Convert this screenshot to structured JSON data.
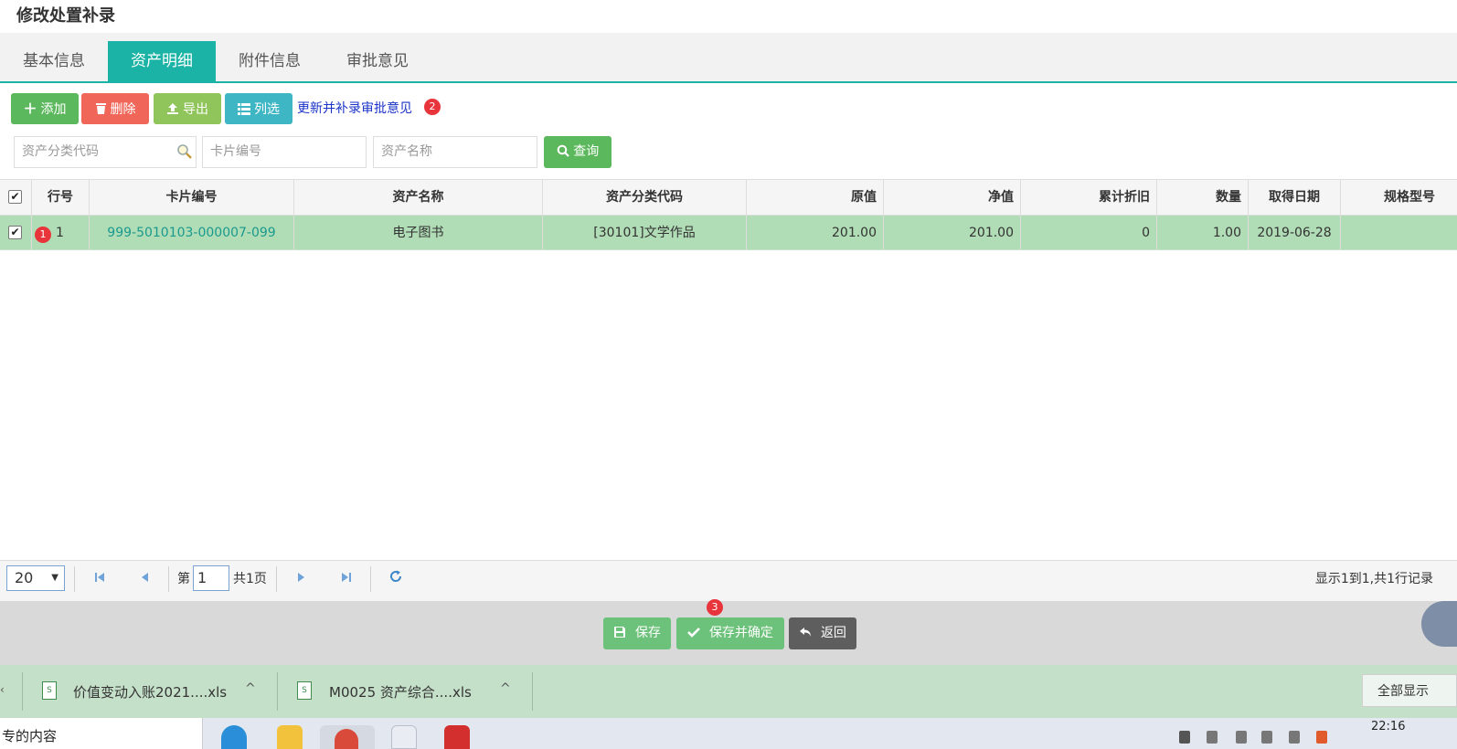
{
  "page": {
    "title": "修改处置补录"
  },
  "tabs": [
    {
      "label": "基本信息",
      "active": false
    },
    {
      "label": "资产明细",
      "active": true
    },
    {
      "label": "附件信息",
      "active": false
    },
    {
      "label": "审批意见",
      "active": false
    }
  ],
  "toolbar": {
    "add_label": "添加",
    "delete_label": "删除",
    "export_label": "导出",
    "columns_label": "列选",
    "update_link": "更新并补录审批意见",
    "badge2": "2"
  },
  "search": {
    "category_placeholder": "资产分类代码",
    "card_placeholder": "卡片编号",
    "name_placeholder": "资产名称",
    "query_label": "查询"
  },
  "grid": {
    "columns": {
      "row_no": "行号",
      "card_no": "卡片编号",
      "asset_name": "资产名称",
      "category_code": "资产分类代码",
      "original_value": "原值",
      "net_value": "净值",
      "accum_depr": "累计折旧",
      "quantity": "数量",
      "acquire_date": "取得日期",
      "spec_model": "规格型号"
    },
    "rows": [
      {
        "badge": "1",
        "row_no": "1",
        "card_no": "999-5010103-000007-099",
        "asset_name": "电子图书",
        "category_code": "[30101]文学作品",
        "original_value": "201.00",
        "net_value": "201.00",
        "accum_depr": "0",
        "quantity": "1.00",
        "acquire_date": "2019-06-28",
        "spec_model": ""
      }
    ]
  },
  "pager": {
    "page_size": "20",
    "page_prefix": "第",
    "current_page": "1",
    "page_total": "共1页",
    "summary": "显示1到1,共1行记录"
  },
  "footer": {
    "badge3": "3",
    "save_label": "保存",
    "confirm_label": "保存并确定",
    "back_label": "返回"
  },
  "downloads": {
    "items": [
      {
        "name": "价值变动入账2021....xls"
      },
      {
        "name": "M0025 资产综合....xls"
      }
    ],
    "show_all": "全部显示"
  },
  "taskbar": {
    "search_text": "专的内容",
    "clock": "22:16"
  },
  "colors": {
    "accent": "#1ab3a5",
    "selected_row": "#b0dcb6",
    "success": "#5cb85c",
    "danger": "#f0675a",
    "badge": "#e8343b"
  }
}
